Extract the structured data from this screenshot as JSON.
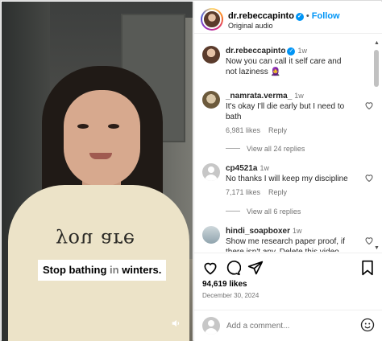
{
  "header": {
    "username": "dr.rebeccapinto",
    "follow_label": "Follow",
    "subtitle": "Original audio"
  },
  "video": {
    "caption_bold": "Stop bathing",
    "caption_dim": " in",
    "caption_end": " winters.",
    "shirt_text": "you are"
  },
  "post": {
    "username": "dr.rebeccapinto",
    "time": "1w",
    "text": "Now you can call it self care and not laziness 🧕"
  },
  "comments": [
    {
      "username": "_namrata.verma_",
      "time": "1w",
      "text": "It's okay I'll die early but I need to bath",
      "likes": "6,981 likes",
      "reply_label": "Reply",
      "replies": "View all 24 replies"
    },
    {
      "username": "cp4521a",
      "time": "1w",
      "text": "No thanks I will keep my discipline",
      "likes": "7,171 likes",
      "reply_label": "Reply",
      "replies": "View all 6 replies"
    },
    {
      "username": "hindi_soapboxer",
      "time": "1w",
      "text": "Show me research paper proof, if there isn't any. Delete this video"
    }
  ],
  "actions": {
    "likes": "94,619 likes",
    "date": "December 30, 2024"
  },
  "add_comment": {
    "placeholder": "Add a comment..."
  },
  "colors": {
    "accent": "#0095f6",
    "muted": "#737373"
  }
}
